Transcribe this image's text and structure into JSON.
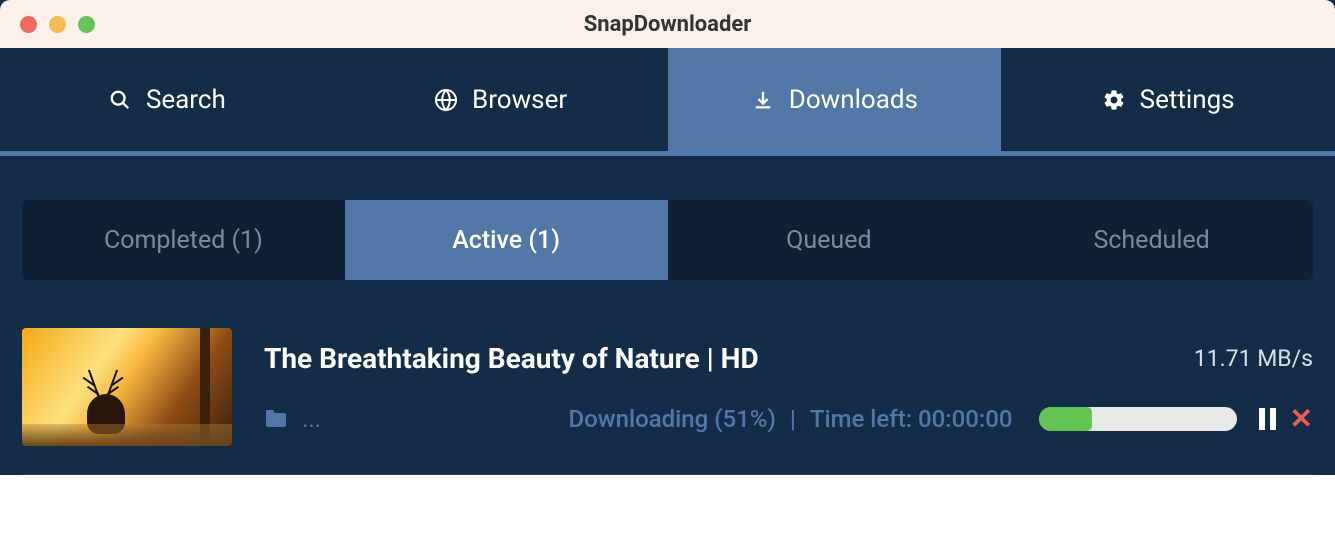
{
  "titlebar": {
    "title": "SnapDownloader"
  },
  "mainNav": {
    "items": [
      {
        "label": "Search",
        "icon": "search"
      },
      {
        "label": "Browser",
        "icon": "globe"
      },
      {
        "label": "Downloads",
        "icon": "download"
      },
      {
        "label": "Settings",
        "icon": "gear"
      }
    ],
    "activeIndex": 2
  },
  "subTabs": {
    "items": [
      {
        "label": "Completed (1)"
      },
      {
        "label": "Active (1)"
      },
      {
        "label": "Queued"
      },
      {
        "label": "Scheduled"
      }
    ],
    "activeIndex": 1
  },
  "download": {
    "title": "The Breathtaking Beauty of Nature | HD",
    "speed": "11.71 MB/s",
    "folderPath": "...",
    "statusLabel": "Downloading (51%)",
    "timeLeftLabel": "Time left: 00:00:00",
    "progressPercent": 27
  }
}
